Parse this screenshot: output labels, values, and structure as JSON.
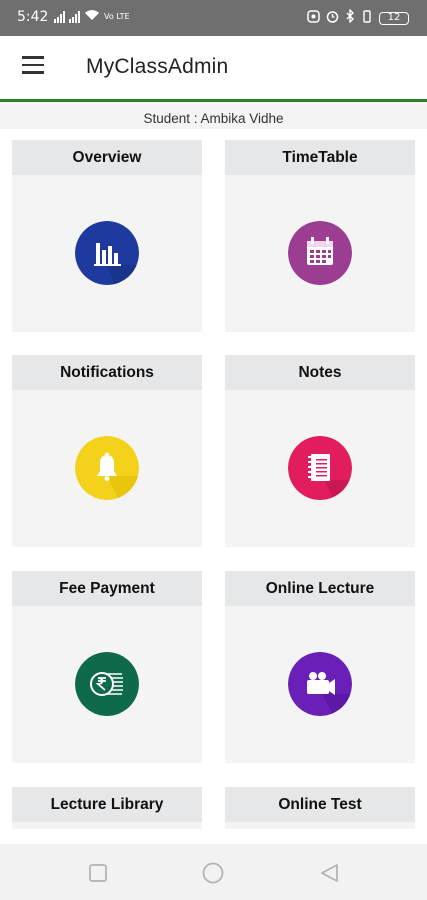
{
  "status_bar": {
    "time": "5:42",
    "network": "Vo LTE",
    "battery": "12"
  },
  "app_bar": {
    "title": "MyClassAdmin",
    "menu_icon": "hamburger-menu-icon",
    "accent_color": "#2e7d32"
  },
  "student_label": "Student : Ambika Vidhe",
  "tiles": [
    {
      "label": "Overview",
      "icon": "bar-chart-icon",
      "color": "#1e3a9e"
    },
    {
      "label": "TimeTable",
      "icon": "calendar-icon",
      "color": "#9c3d92"
    },
    {
      "label": "Notifications",
      "icon": "bell-icon",
      "color": "#f4d21c"
    },
    {
      "label": "Notes",
      "icon": "notepad-icon",
      "color": "#e11d5e"
    },
    {
      "label": "Fee Payment",
      "icon": "rupee-coins-icon",
      "color": "#0f6a4c"
    },
    {
      "label": "Online Lecture",
      "icon": "video-camera-icon",
      "color": "#6a1fb8"
    },
    {
      "label": "Lecture Library",
      "icon": "",
      "color": ""
    },
    {
      "label": "Online Test",
      "icon": "",
      "color": ""
    }
  ],
  "nav_bar": {
    "recents_icon": "square-recents-icon",
    "home_icon": "circle-home-icon",
    "back_icon": "triangle-back-icon"
  }
}
